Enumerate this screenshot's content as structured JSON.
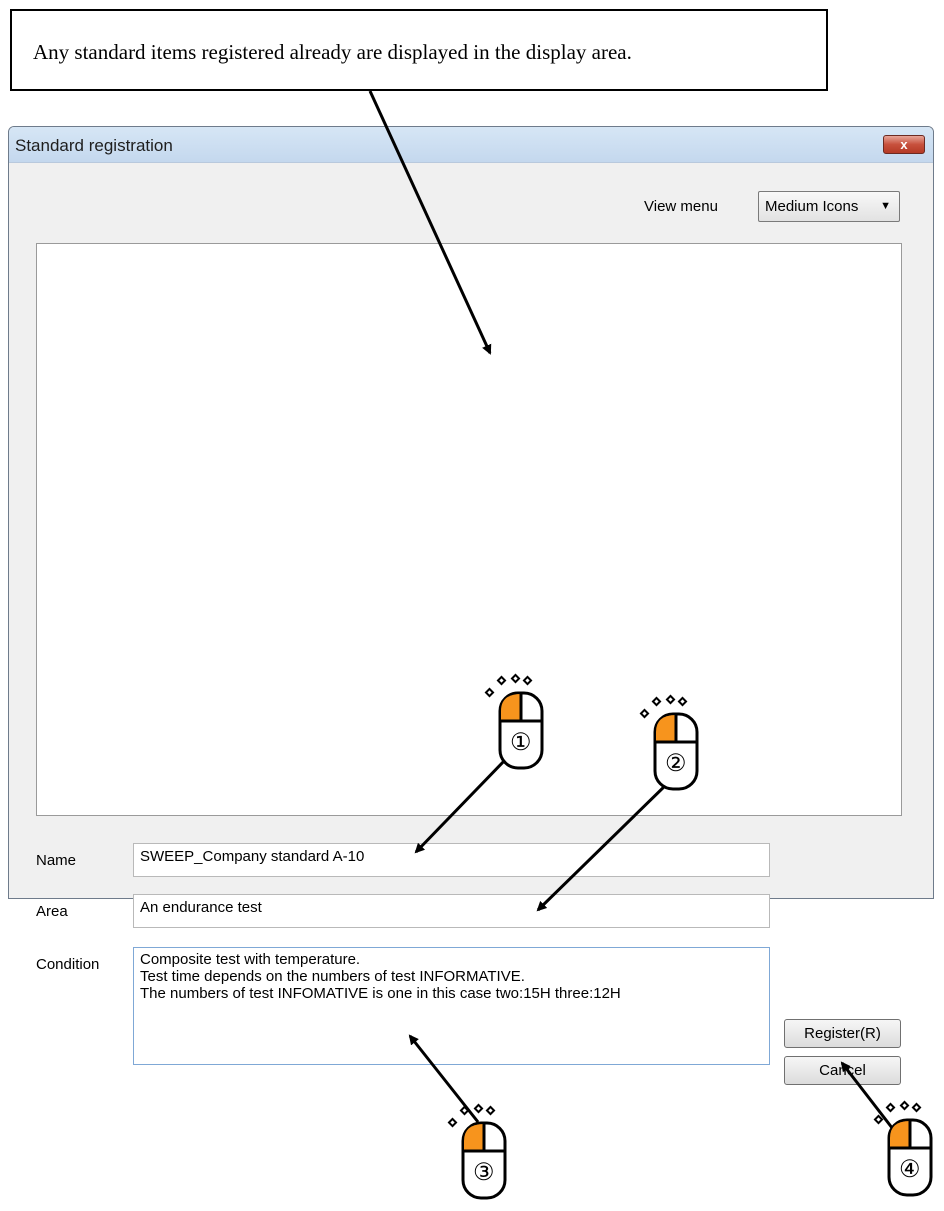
{
  "callout": {
    "text": "Any standard items registered already are displayed in the display area."
  },
  "window": {
    "title": "Standard registration",
    "close_glyph": "x"
  },
  "view_menu": {
    "label": "View menu",
    "selected": "Medium Icons"
  },
  "form": {
    "name_label": "Name",
    "name_value": "SWEEP_Company standard  A-10",
    "area_label": "Area",
    "area_value": "An endurance test",
    "condition_label": "Condition",
    "condition_value": "Composite test with temperature.\nTest time depends on the numbers of test INFORMATIVE.\nThe numbers of test INFOMATIVE is one in this case two:15H three:12H"
  },
  "buttons": {
    "register": "Register(R)",
    "cancel": "Cancel"
  },
  "markers": [
    {
      "label": "①",
      "icon": "mouse-left-click-icon"
    },
    {
      "label": "②",
      "icon": "mouse-left-click-icon"
    },
    {
      "label": "③",
      "icon": "mouse-left-click-icon"
    },
    {
      "label": "④",
      "icon": "mouse-left-click-icon"
    }
  ],
  "colors": {
    "mouse_button": "#f7941d",
    "window_bg": "#f0f0f0",
    "titlebar": "#c9dcf0",
    "close_button": "#c7503c"
  }
}
